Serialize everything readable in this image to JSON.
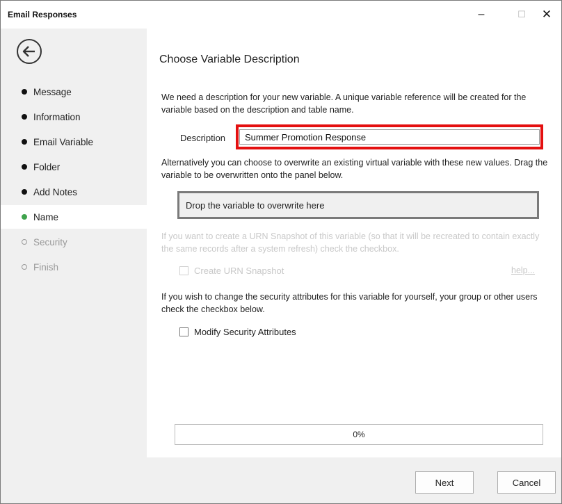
{
  "window": {
    "title": "Email Responses",
    "minimize_glyph": "–",
    "maximize_glyph": "☐",
    "close_glyph": "✕"
  },
  "sidebar": {
    "back_icon": "back-arrow-icon",
    "items": [
      {
        "label": "Message",
        "state": "done"
      },
      {
        "label": "Information",
        "state": "done"
      },
      {
        "label": "Email Variable",
        "state": "done"
      },
      {
        "label": "Folder",
        "state": "done"
      },
      {
        "label": "Add Notes",
        "state": "done"
      },
      {
        "label": "Name",
        "state": "active"
      },
      {
        "label": "Security",
        "state": "pending"
      },
      {
        "label": "Finish",
        "state": "pending"
      }
    ],
    "active_color": "#3fa34d"
  },
  "main": {
    "heading": "Choose Variable Description",
    "intro": "We need a description for your new variable.  A unique variable reference will be created for the variable based on the description and table name.",
    "description_label": "Description",
    "description_value": "Summer Promotion Response",
    "overwrite_text": "Alternatively you can choose to overwrite an existing virtual variable with these new values. Drag the variable to be overwritten onto the panel below.",
    "dropzone_text": "Drop the variable to overwrite here",
    "urn_text": "If you want to create a URN Snapshot of this variable (so that it will be recreated to contain exactly the same records after a system refresh) check the checkbox.",
    "urn_checkbox_label": "Create URN Snapshot",
    "help_link": "help...",
    "security_text": "If you wish to change the security attributes for this variable for yourself, your group or other users check the checkbox below.",
    "security_checkbox_label": "Modify Security Attributes",
    "progress_text": "0%",
    "progress_value": 0,
    "highlight_color": "#e41010"
  },
  "footer": {
    "next_label": "Next",
    "cancel_label": "Cancel"
  }
}
